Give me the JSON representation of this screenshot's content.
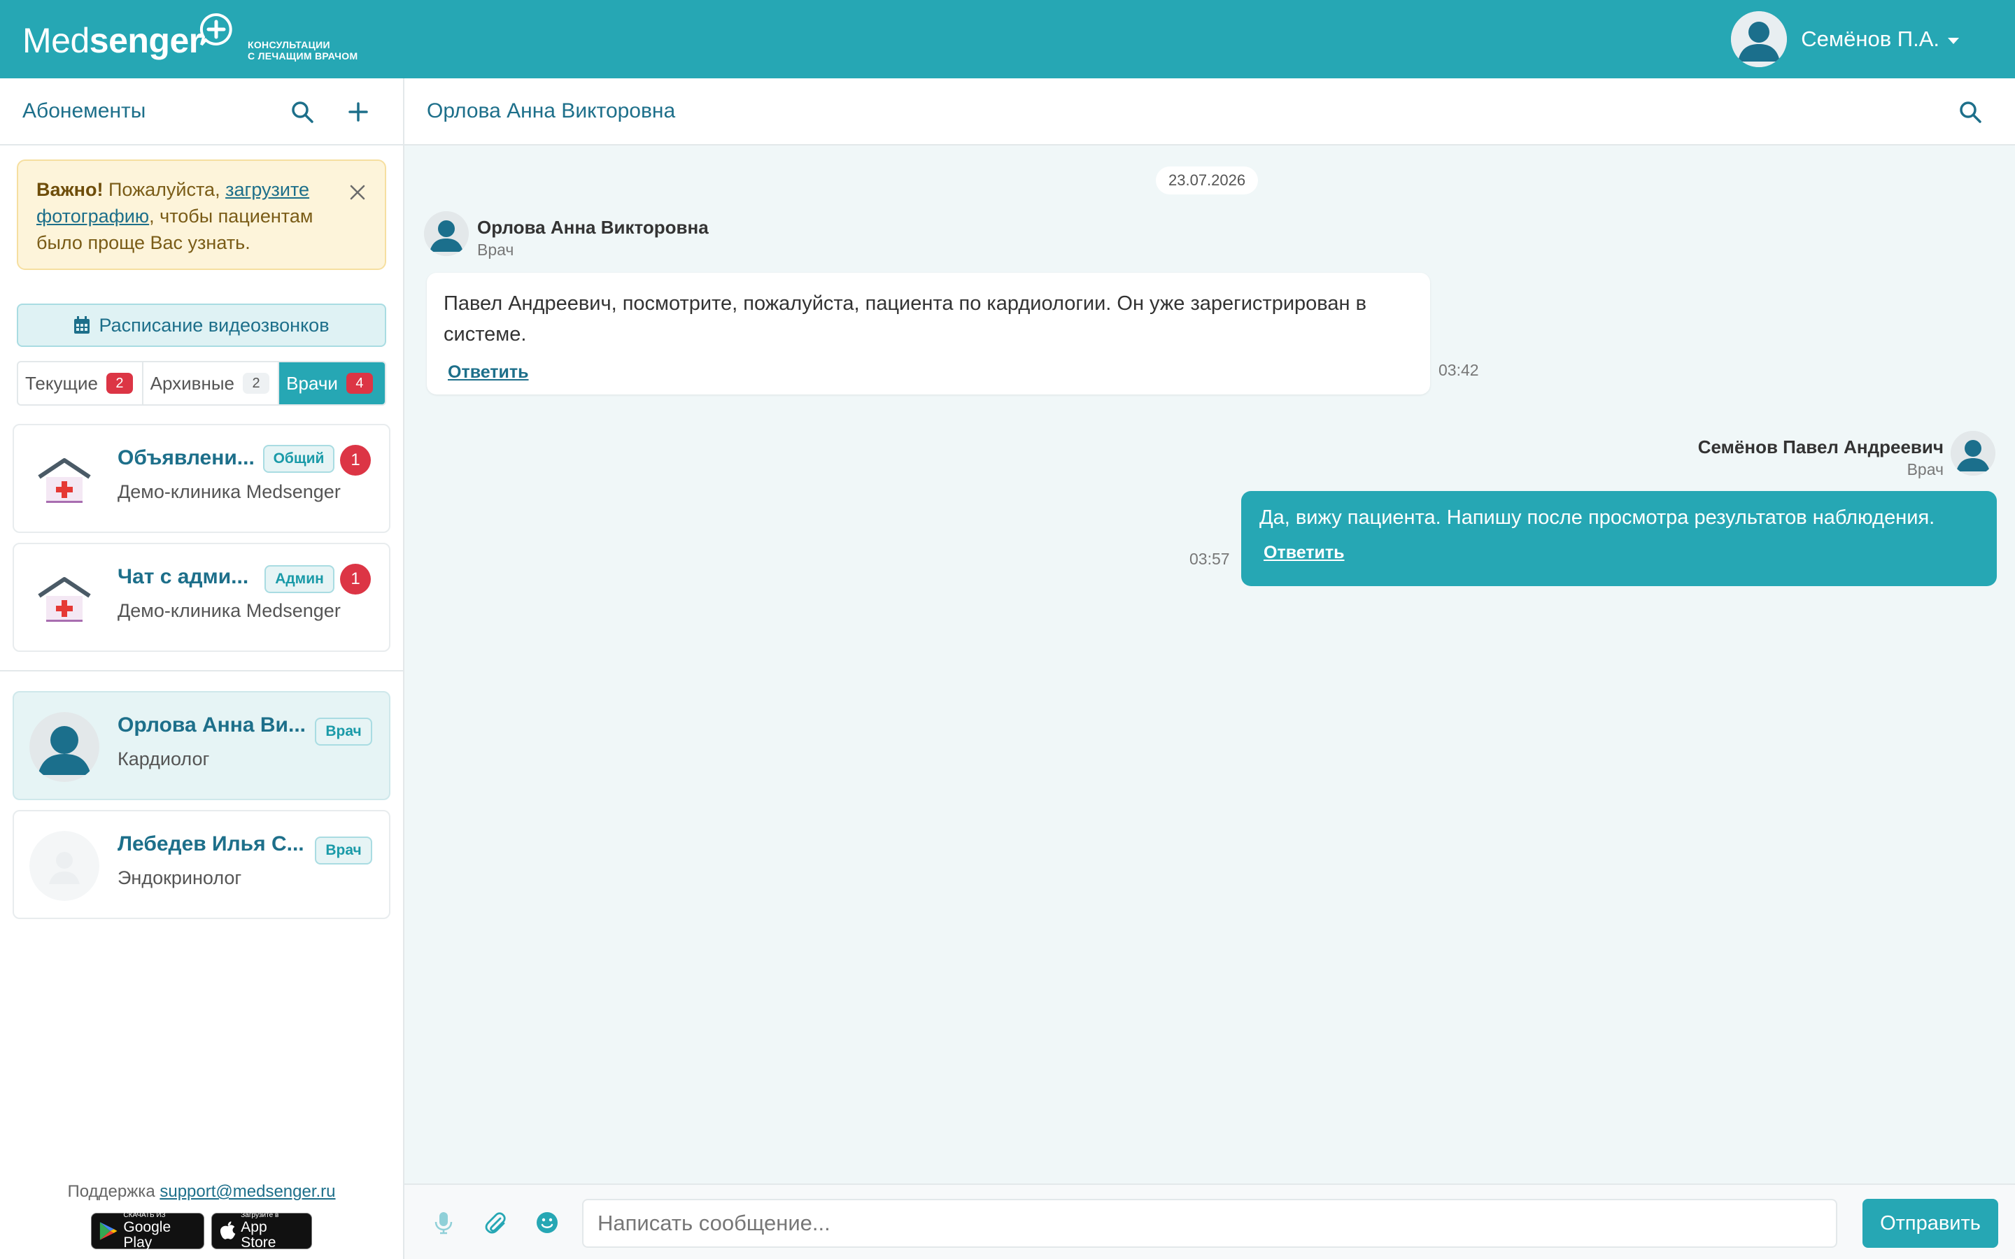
{
  "header": {
    "logo_light": "Med",
    "logo_bold": "senger",
    "logo_tag_line1": "КОНСУЛЬТАЦИИ",
    "logo_tag_line2": "С ЛЕЧАЩИМ ВРАЧОМ",
    "user_name": "Семёнов П.А."
  },
  "sidebar": {
    "title": "Абонементы",
    "alert": {
      "strong": "Важно!",
      "text_before": " Пожалуйста, ",
      "link": "загрузите фотографию",
      "text_after": ", чтобы пациентам было проще Вас узнать."
    },
    "schedule_button": "Расписание видеозвонков",
    "tabs": [
      {
        "label": "Текущие",
        "count": "2"
      },
      {
        "label": "Архивные",
        "count": "2"
      },
      {
        "label": "Врачи",
        "count": "4"
      }
    ],
    "group_chats": [
      {
        "title": "Объявлени...",
        "subtitle": "Демо-клиника Medsenger",
        "tag": "Общий",
        "unread": "1"
      },
      {
        "title": "Чат с адми...",
        "subtitle": "Демо-клиника Medsenger",
        "tag": "Админ",
        "unread": "1"
      }
    ],
    "doctors": [
      {
        "title": "Орлова Анна Ви...",
        "subtitle": "Кардиолог",
        "tag": "Врач"
      },
      {
        "title": "Лебедев Илья С...",
        "subtitle": "Эндокринолог",
        "tag": "Врач"
      }
    ],
    "support_label": "Поддержка",
    "support_email": "support@medsenger.ru",
    "google_play_small": "СКАЧАТЬ ИЗ",
    "google_play_big": "Google Play",
    "app_store_small": "Загрузите в",
    "app_store_big": "App Store"
  },
  "chat": {
    "title": "Орлова Анна Викторовна",
    "date": "23.07.2026",
    "messages": [
      {
        "author": "Орлова Анна Викторовна",
        "role": "Врач",
        "text": "Павел Андреевич, посмотрите, пожалуйста, пациента по кардиологии. Он уже зарегистрирован в системе.",
        "reply": "Ответить",
        "time": "03:42"
      },
      {
        "author": "Семёнов Павел Андреевич",
        "role": "Врач",
        "text": "Да, вижу пациента. Напишу после просмотра результатов наблюдения.",
        "reply": "Ответить",
        "time": "03:57"
      }
    ],
    "composer_placeholder": "Написать сообщение...",
    "send_label": "Отправить"
  },
  "colors": {
    "brand": "#26a7b4",
    "brand_dark": "#1d6f8a",
    "badge_red": "#dc3545",
    "alert_bg": "#fdf4da",
    "chat_bg": "#f0f7f8"
  },
  "icons": [
    "logo-bubble-plus-icon",
    "search-icon",
    "plus-icon",
    "close-icon",
    "calendar-icon",
    "clinic-house-icon",
    "user-avatar-icon",
    "microphone-icon",
    "paperclip-icon",
    "smiley-icon",
    "google-play-icon",
    "apple-icon",
    "caret-down-icon"
  ]
}
